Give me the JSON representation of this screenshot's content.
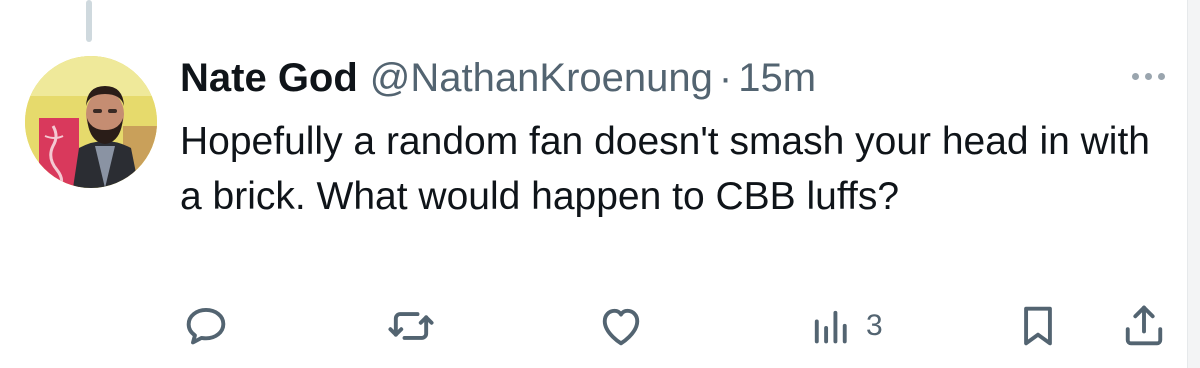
{
  "tweet": {
    "author_name": "Nate God",
    "author_handle": "@NathanKroenung",
    "separator": "·",
    "timestamp": "15m",
    "text": "Hopefully a random fan doesn't smash your head in with a brick. What would happen to CBB luffs?"
  },
  "actions": {
    "reply_icon": "speech-bubble-icon",
    "retweet_icon": "retweet-arrows-icon",
    "like_icon": "heart-icon",
    "views_icon": "bar-chart-icon",
    "views_count": "3",
    "bookmark_icon": "bookmark-icon",
    "share_icon": "share-upload-icon"
  },
  "colors": {
    "text_primary": "#0f1419",
    "text_secondary": "#536471",
    "icon": "#536471",
    "thread_line": "#cfd9de"
  }
}
